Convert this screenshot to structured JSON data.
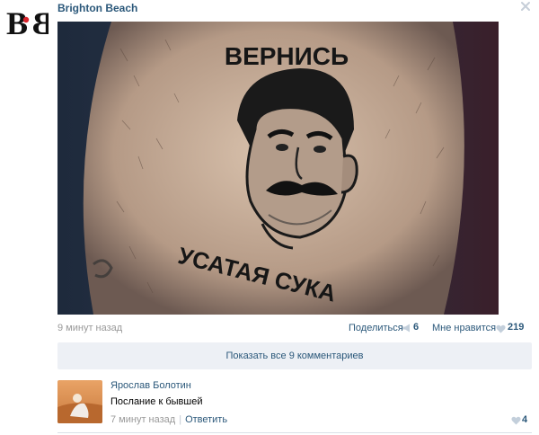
{
  "post": {
    "author": "Brighton Beach",
    "time": "9 минут назад",
    "photo_texts": {
      "top": "ВЕРНИСЬ",
      "bottom": "УСАТАЯ СУКА"
    },
    "share_label": "Поделиться",
    "share_count": "6",
    "like_label": "Мне нравится",
    "like_count": "219",
    "show_all_comments": "Показать все 9 комментариев"
  },
  "comment": {
    "author": "Ярослав Болотин",
    "text": "Послание к бывшей",
    "time": "7 минут назад",
    "separator": "|",
    "reply_label": "Ответить",
    "like_count": "4"
  },
  "icons": {
    "logo": "brighton-beach-logo",
    "close": "close-icon",
    "share": "megaphone-icon",
    "like": "heart-icon"
  },
  "colors": {
    "link": "#2b587a",
    "muted": "#999999",
    "button_bg": "#edf0f5",
    "logo_red": "#d8242c"
  }
}
